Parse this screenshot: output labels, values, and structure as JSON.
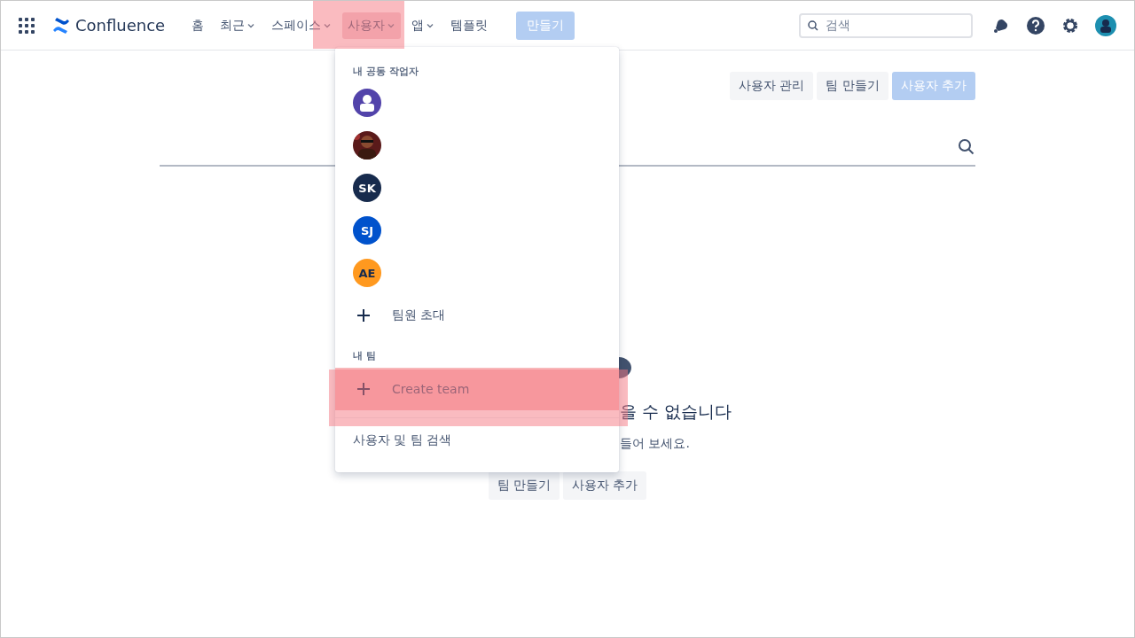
{
  "nav": {
    "product": "Confluence",
    "items": [
      {
        "label": "홈",
        "dropdown": false,
        "highlighted": false
      },
      {
        "label": "최근",
        "dropdown": true,
        "highlighted": false
      },
      {
        "label": "스페이스",
        "dropdown": true,
        "highlighted": false
      },
      {
        "label": "사용자",
        "dropdown": true,
        "highlighted": true
      },
      {
        "label": "앱",
        "dropdown": true,
        "highlighted": false
      },
      {
        "label": "템플릿",
        "dropdown": false,
        "highlighted": false
      }
    ],
    "create_button": "만들기",
    "search": {
      "placeholder": "검색"
    }
  },
  "toolbar_buttons": [
    {
      "label": "사용자 관리",
      "primary": false
    },
    {
      "label": "팀 만들기",
      "primary": false
    },
    {
      "label": "사용자 추가",
      "primary": true
    }
  ],
  "empty_state": {
    "title": "을 수 없습니다",
    "subtitle": "들어 보세요.",
    "buttons": [
      "팀 만들기",
      "사용자 추가"
    ]
  },
  "menu": {
    "collaborators_heading": "내 공동 작업자",
    "collaborators": [
      {
        "kind": "silhouette",
        "color": "#5243aa"
      },
      {
        "kind": "picture"
      },
      {
        "kind": "initials",
        "initials": "SK",
        "color": "#172b4d"
      },
      {
        "kind": "initials",
        "initials": "SJ",
        "color": "#0052cc"
      },
      {
        "kind": "initials",
        "initials": "AE",
        "color": "#ff991f"
      }
    ],
    "invite": {
      "label": "팀원 초대",
      "highlighted": false
    },
    "teams_heading": "내 팀",
    "create_team": {
      "label": "Create team",
      "highlighted": true
    },
    "search_link": "사용자 및 팀 검색"
  }
}
